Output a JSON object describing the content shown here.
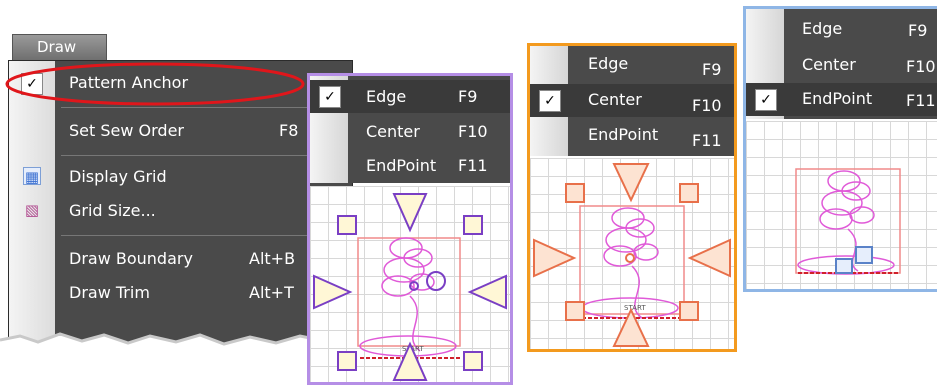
{
  "menu": {
    "title": "Draw",
    "items": [
      {
        "label": "Pattern Anchor",
        "shortcut": ""
      },
      {
        "label": "Set Sew Order",
        "shortcut": "F8"
      },
      {
        "label": "Display Grid",
        "shortcut": ""
      },
      {
        "label": "Grid Size...",
        "shortcut": ""
      },
      {
        "label": "Draw Boundary",
        "shortcut": "Alt+B"
      },
      {
        "label": "Draw Trim",
        "shortcut": "Alt+T"
      }
    ]
  },
  "submenus": {
    "purple": {
      "items": [
        {
          "label": "Edge",
          "key": "F9"
        },
        {
          "label": "Center",
          "key": "F10"
        },
        {
          "label": "EndPoint",
          "key": "F11"
        }
      ],
      "checked": "Edge",
      "color": "#b58ee6"
    },
    "orange": {
      "items": [
        {
          "label": "Edge",
          "key": "F9"
        },
        {
          "label": "Center",
          "key": "F10"
        },
        {
          "label": "EndPoint",
          "key": "F11"
        }
      ],
      "checked": "Center",
      "color": "#f39a1e"
    },
    "blue": {
      "items": [
        {
          "label": "Edge",
          "key": "F9"
        },
        {
          "label": "Center",
          "key": "F10"
        },
        {
          "label": "EndPoint",
          "key": "F11"
        }
      ],
      "checked": "EndPoint",
      "color": "#8fb6e6"
    }
  },
  "colors": {
    "highlight_ring": "#e0161b",
    "menu_bg": "#4a4a4a"
  },
  "pattern_label": "START"
}
